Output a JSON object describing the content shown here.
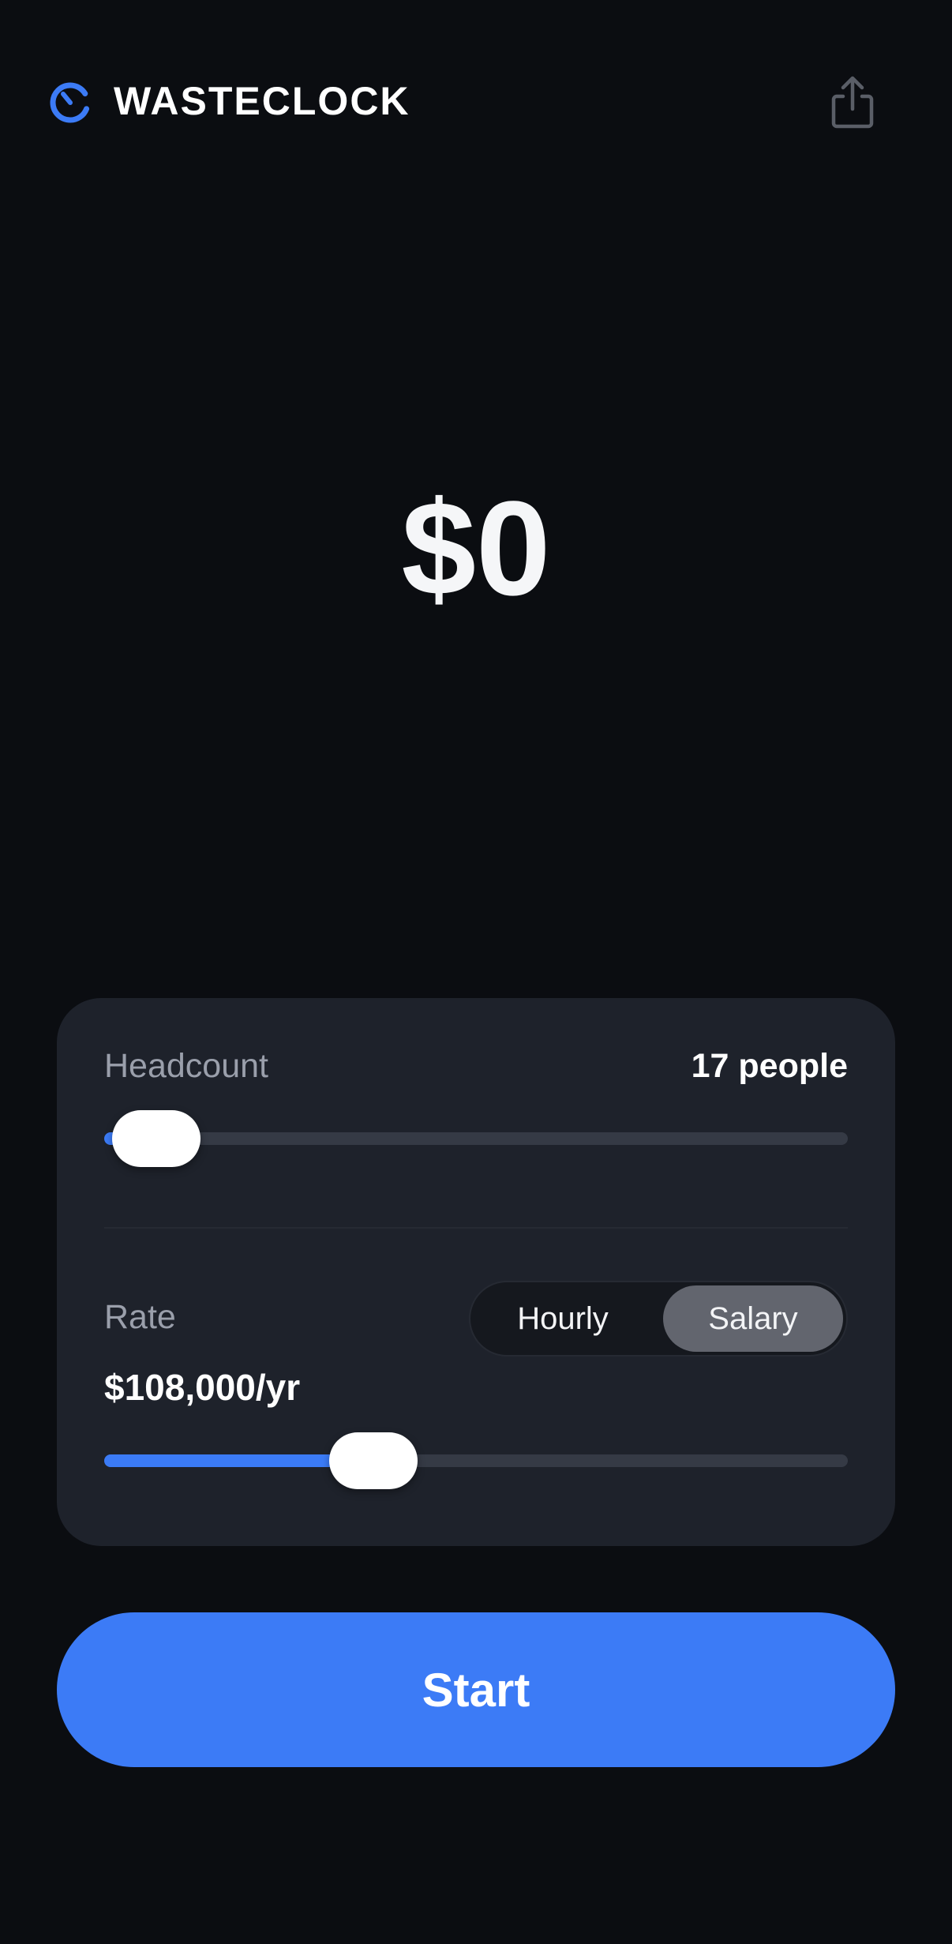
{
  "header": {
    "brand": "WASTECLOCK",
    "logo_icon": "stopwatch-icon",
    "share_icon": "share-icon"
  },
  "amount": "$0",
  "settings": {
    "headcount": {
      "label": "Headcount",
      "value_text": "17 people",
      "slider_fraction": 0.0
    },
    "rate": {
      "label": "Rate",
      "modes": [
        "Hourly",
        "Salary"
      ],
      "selected_mode": "Salary",
      "value_text": "$108,000/yr",
      "slider_fraction": 0.335
    }
  },
  "start_button": {
    "label": "Start"
  },
  "colors": {
    "background": "#0b0d11",
    "card": "#1e222b",
    "accent": "#3c7bf6",
    "segment_selected": "#62656e"
  }
}
